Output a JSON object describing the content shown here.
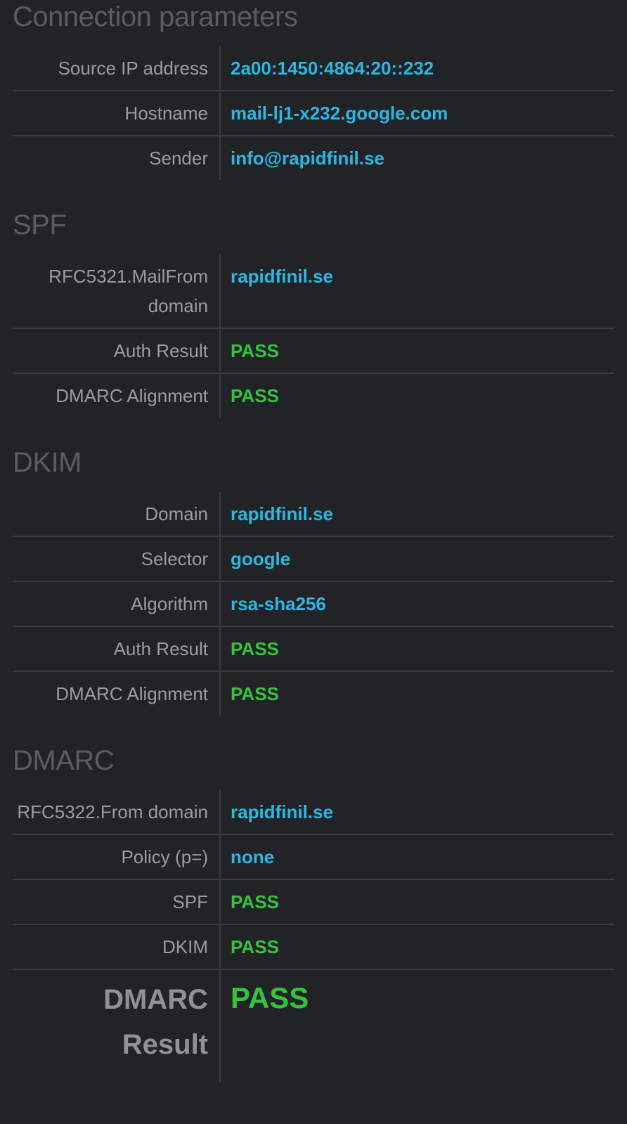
{
  "colors": {
    "background": "#212327",
    "heading": "#585c63",
    "label": "#9a9ca0",
    "link_value": "#2ab8e2",
    "pass_value": "#34c43c",
    "divider": "#383b41"
  },
  "connection": {
    "title": "Connection parameters",
    "rows": [
      {
        "label": "Source IP address",
        "value": "2a00:1450:4864:20::232"
      },
      {
        "label": "Hostname",
        "value": "mail-lj1-x232.google.com"
      },
      {
        "label": "Sender",
        "value": "info@rapidfinil.se"
      }
    ]
  },
  "spf": {
    "title": "SPF",
    "rows": [
      {
        "label": "RFC5321.MailFrom domain",
        "value": "rapidfinil.se"
      },
      {
        "label": "Auth Result",
        "value": "PASS"
      },
      {
        "label": "DMARC Alignment",
        "value": "PASS"
      }
    ]
  },
  "dkim": {
    "title": "DKIM",
    "rows": [
      {
        "label": "Domain",
        "value": "rapidfinil.se"
      },
      {
        "label": "Selector",
        "value": "google"
      },
      {
        "label": "Algorithm",
        "value": "rsa-sha256"
      },
      {
        "label": "Auth Result",
        "value": "PASS"
      },
      {
        "label": "DMARC Alignment",
        "value": "PASS"
      }
    ]
  },
  "dmarc": {
    "title": "DMARC",
    "rows": [
      {
        "label": "RFC5322.From domain",
        "value": "rapidfinil.se"
      },
      {
        "label": "Policy (p=)",
        "value": "none"
      },
      {
        "label": "SPF",
        "value": "PASS"
      },
      {
        "label": "DKIM",
        "value": "PASS"
      }
    ],
    "result": {
      "label": "DMARC Result",
      "value": "PASS"
    }
  }
}
